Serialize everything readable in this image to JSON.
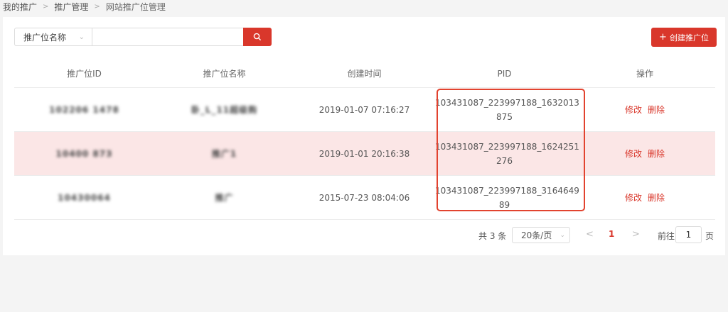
{
  "breadcrumb": [
    "我的推广",
    "推广管理",
    "网站推广位管理"
  ],
  "search": {
    "select_label": "推广位名称",
    "input_value": "",
    "placeholder": ""
  },
  "create_button": "创建推广位",
  "table": {
    "headers": [
      "推广位ID",
      "推广位名称",
      "创建时间",
      "PID",
      "操作"
    ],
    "rows": [
      {
        "id": "102206 1478",
        "name": "卧_L_11超级购",
        "created": "2019-01-07 07:16:27",
        "pid_line1": "103431087_223997188_1632013",
        "pid_line2": "875",
        "edit": "修改",
        "delete": "删除"
      },
      {
        "id": "10400 873",
        "name": "推广1",
        "created": "2019-01-01 20:16:38",
        "pid_line1": "103431087_223997188_1624251",
        "pid_line2": "276",
        "edit": "修改",
        "delete": "删除"
      },
      {
        "id": "10430064",
        "name": "推广",
        "created": "2015-07-23 08:04:06",
        "pid_line1": "103431087_223997188_3164649",
        "pid_line2": "89",
        "edit": "修改",
        "delete": "删除"
      }
    ]
  },
  "pagination": {
    "total": "共 3 条",
    "page_size": "20条/页",
    "current": "1",
    "goto_label": "前往",
    "goto_value": "1",
    "goto_unit": "页"
  },
  "colors": {
    "accent": "#d9372b",
    "row_highlight": "#fbe6e6"
  }
}
